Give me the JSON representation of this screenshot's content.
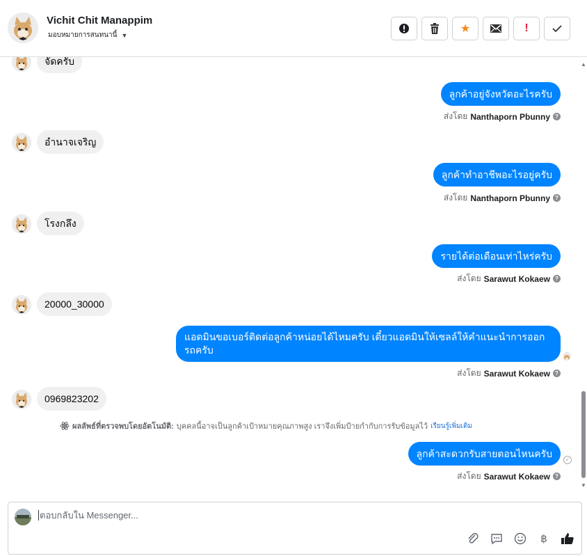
{
  "header": {
    "name": "Vichit Chit Manappim",
    "assign_label": "มอบหมายการสนทนานี้",
    "actions": [
      "spam-icon",
      "trash-icon",
      "star-icon",
      "mark-unread-icon",
      "follow-up-icon",
      "done-icon"
    ],
    "accent_star": "#f28a19",
    "accent_red": "#e41e3f"
  },
  "messages": [
    {
      "from": "customer",
      "text": "จัดครับ"
    },
    {
      "from": "page",
      "text": "ลูกค้าอยู่จังหวัดอะไรครับ",
      "sent_by_prefix": "ส่งโดย",
      "sent_by": "Nanthaporn Pbunny"
    },
    {
      "from": "customer",
      "text": "อำนาจเจริญ"
    },
    {
      "from": "page",
      "text": "ลูกค้าทำอาชีพอะไรอยู่ครับ",
      "sent_by_prefix": "ส่งโดย",
      "sent_by": "Nanthaporn Pbunny"
    },
    {
      "from": "customer",
      "text": "โรงกลึง"
    },
    {
      "from": "page",
      "text": "รายได้ต่อเดือนเท่าไหร่ครับ",
      "sent_by_prefix": "ส่งโดย",
      "sent_by": "Sarawut Kokaew"
    },
    {
      "from": "customer",
      "text": "20000_30000"
    },
    {
      "from": "page",
      "text": "แอดมินขอเบอร์ติดต่อลูกค้าหน่อยได้ไหมครับ เดี๋ยวแอดมินให้เซลล์ให้คำแนะนำการออกรถครับ",
      "sent_by_prefix": "ส่งโดย",
      "sent_by": "Sarawut Kokaew"
    },
    {
      "from": "customer",
      "text": "0969823202"
    },
    {
      "from": "page",
      "text": "ลูกค้าสะดวกรับสายตอนไหนครับ",
      "sent_by_prefix": "ส่งโดย",
      "sent_by": "Sarawut Kokaew"
    }
  ],
  "auto_note": {
    "title": "ผลลัพธ์ที่ตรวจพบโดยอัตโนมัติ:",
    "body": "บุคคลนี้อาจเป็นลูกค้าเป้าหมายคุณภาพสูง เราจึงเพิ่มป้ายกำกับการรับข้อมูลไว้",
    "link": "เรียนรู้เพิ่มเติม"
  },
  "composer": {
    "placeholder": "ตอบกลับใน Messenger...",
    "tools": [
      "attach-icon",
      "saved-reply-icon",
      "emoji-icon",
      "baht-icon",
      "like-icon"
    ]
  },
  "colors": {
    "bubble_out": "#0084ff",
    "bubble_in": "#f0f0f0",
    "link": "#216fdb"
  }
}
